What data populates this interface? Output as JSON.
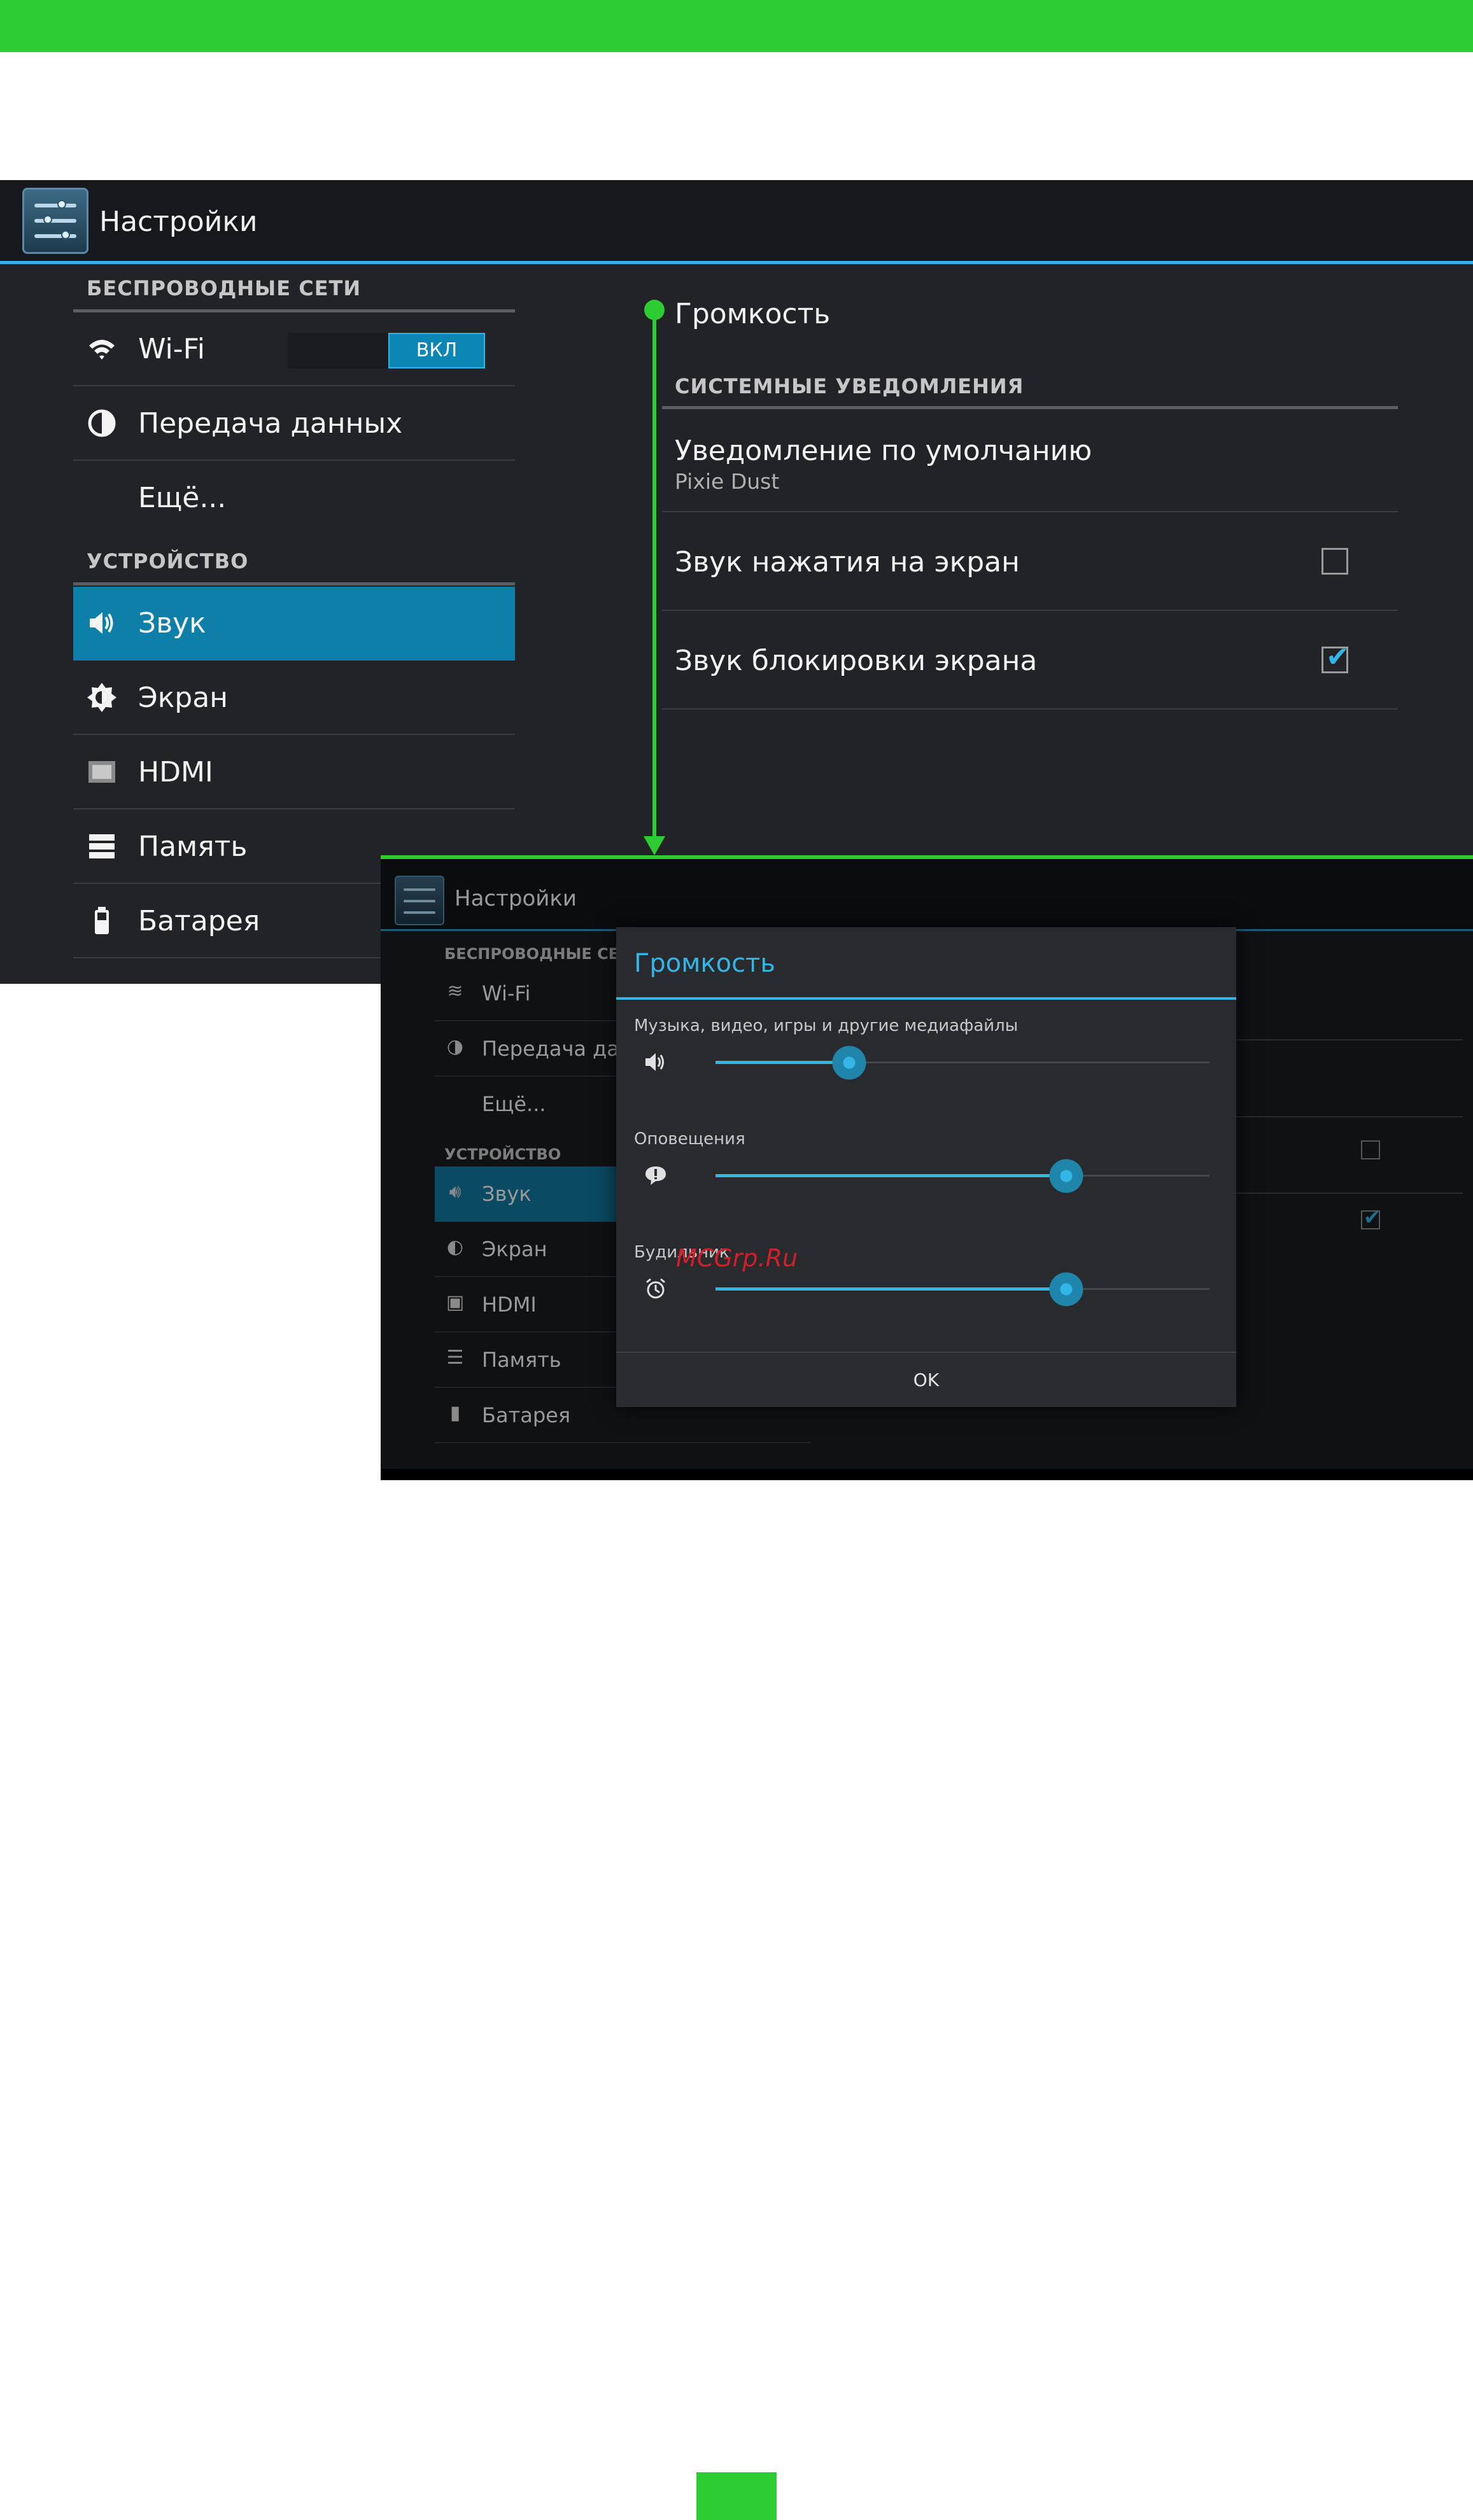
{
  "decor": {
    "accent_green": "#2ecc33",
    "holo_blue": "#33b5e5"
  },
  "screen1": {
    "app_title": "Настройки",
    "sections": [
      {
        "title": "БЕСПРОВОДНЫЕ СЕТИ",
        "items": [
          {
            "label": "Wi-Fi",
            "icon": "wifi-icon",
            "toggle": "ВКЛ"
          },
          {
            "label": "Передача данных",
            "icon": "data-usage-icon"
          },
          {
            "label": "Ещё...",
            "icon": ""
          }
        ]
      },
      {
        "title": "УСТРОЙСТВО",
        "items": [
          {
            "label": "Звук",
            "icon": "speaker-icon",
            "selected": true
          },
          {
            "label": "Экран",
            "icon": "brightness-icon"
          },
          {
            "label": "HDMI",
            "icon": "hdmi-icon"
          },
          {
            "label": "Память",
            "icon": "storage-icon"
          },
          {
            "label": "Батарея",
            "icon": "battery-icon"
          }
        ]
      }
    ],
    "detail": {
      "volume": "Громкость",
      "category": "СИСТЕМНЫЕ УВЕДОМЛЕНИЯ",
      "default_notification": {
        "title": "Уведомление по умолчанию",
        "value": "Pixie Dust"
      },
      "touch_sound": {
        "title": "Звук нажатия на экран",
        "checked": false
      },
      "lock_sound": {
        "title": "Звук блокировки экрана",
        "checked": true
      }
    }
  },
  "screen2": {
    "app_title": "Настройки",
    "sections": [
      {
        "title": "БЕСПРОВОДНЫЕ СЕТИ",
        "items": [
          "Wi-Fi",
          "Передача данных",
          "Ещё..."
        ]
      },
      {
        "title": "УСТРОЙСТВО",
        "items": [
          "Звук",
          "Экран",
          "HDMI",
          "Память",
          "Батарея"
        ]
      }
    ],
    "dialog": {
      "title": "Громкость",
      "sliders": [
        {
          "label": "Музыка, видео, игры и другие медиафайлы",
          "icon": "speaker-icon",
          "value": 0.27
        },
        {
          "label": "Оповещения",
          "icon": "notification-icon",
          "value": 0.71
        },
        {
          "label": "Будильник",
          "icon": "alarm-icon",
          "value": 0.71
        }
      ],
      "ok": "OK"
    }
  },
  "watermark": "MCGrp.Ru"
}
